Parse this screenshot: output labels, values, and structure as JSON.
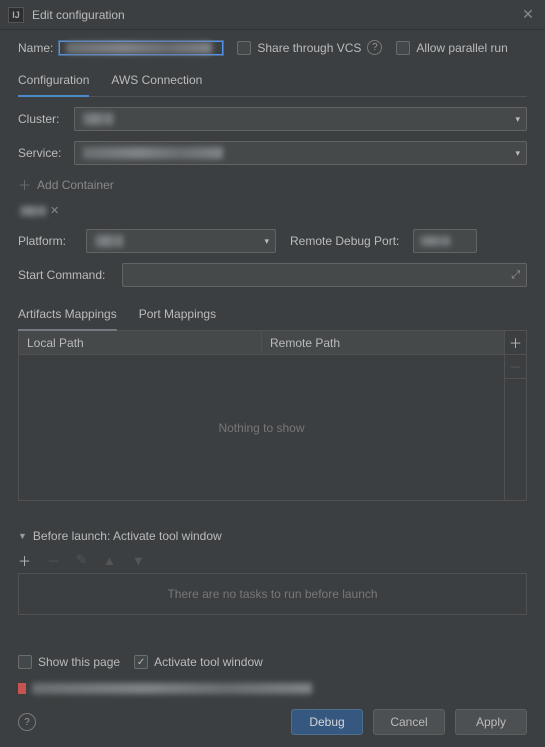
{
  "titlebar": {
    "title": "Edit configuration",
    "icon_letter": "IJ"
  },
  "name": {
    "label": "Name:"
  },
  "share_vcs": {
    "label": "Share through VCS"
  },
  "allow_parallel": {
    "label": "Allow parallel run"
  },
  "tabs": {
    "config": "Configuration",
    "aws": "AWS Connection"
  },
  "cluster": {
    "label": "Cluster:"
  },
  "service": {
    "label": "Service:"
  },
  "add_container": "Add Container",
  "platform": {
    "label": "Platform:"
  },
  "remote_debug": {
    "label": "Remote Debug Port:"
  },
  "start_cmd": {
    "label": "Start Command:"
  },
  "subtabs": {
    "artifacts": "Artifacts Mappings",
    "port": "Port Mappings"
  },
  "table": {
    "local": "Local Path",
    "remote": "Remote Path",
    "empty": "Nothing to show"
  },
  "before_launch": {
    "header": "Before launch: Activate tool window",
    "empty": "There are no tasks to run before launch"
  },
  "show_page": "Show this page",
  "activate_tool": "Activate tool window",
  "buttons": {
    "debug": "Debug",
    "cancel": "Cancel",
    "apply": "Apply"
  }
}
